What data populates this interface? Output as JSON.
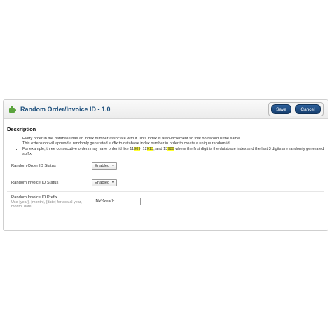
{
  "header": {
    "title": "Random Order/Invoice ID - 1.0",
    "icon": "puzzle-icon",
    "save_label": "Save",
    "cancel_label": "Cancel"
  },
  "description": {
    "title": "Description",
    "line1": "Every order in the database has an index number associate with it. This index is auto-increment so that no record is the same.",
    "line2": "This extension will append a randomly generated suffix to database index number in order to create a unique random id",
    "line3": {
      "p1": "For example, three consecutive orders may have order id like 11",
      "h1": "989",
      "p2": ", 12",
      "h2": "013",
      "p3": ", and 13",
      "h3": "989",
      "p4": " where the first digit is the database index and the last 3 digits are randomly generated suffix"
    }
  },
  "form": {
    "order_status_label": "Random Order ID Status",
    "order_status_value": "Enabled",
    "invoice_status_label": "Random Invoice ID Status",
    "invoice_status_value": "Enabled",
    "prefix_label": "Random Invoice ID Prefix",
    "prefix_hint": "Use {year}, {month}, {date} for actual year, month, date",
    "prefix_value": "INV-{year}-"
  },
  "colors": {
    "accent": "#1d4f7c",
    "button": "#1f4f86",
    "highlight": "#ffff2e"
  }
}
